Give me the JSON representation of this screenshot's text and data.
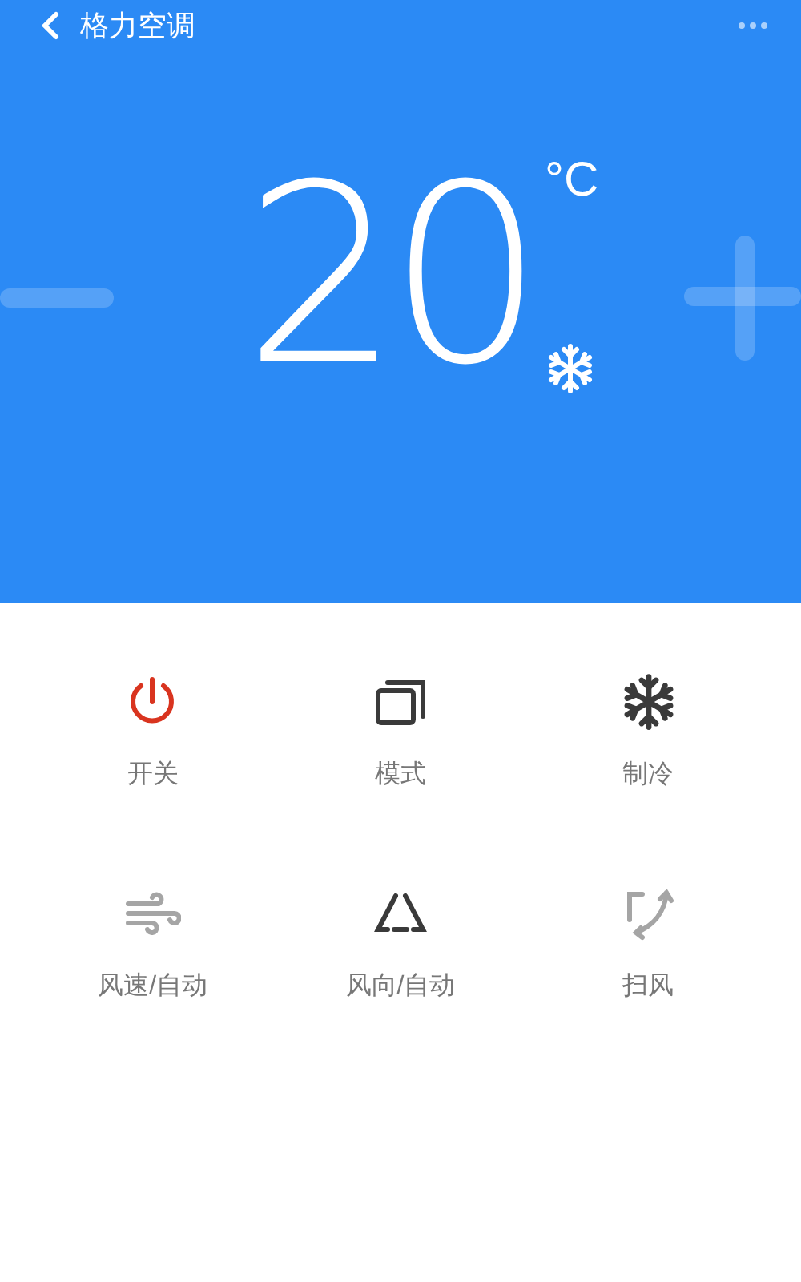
{
  "header": {
    "title": "格力空调"
  },
  "temperature": {
    "value": "20",
    "unit": "°C"
  },
  "controls": [
    {
      "label": "开关",
      "kind": "power",
      "active": true,
      "disabled": false
    },
    {
      "label": "模式",
      "kind": "mode",
      "active": false,
      "disabled": false
    },
    {
      "label": "制冷",
      "kind": "cool",
      "active": false,
      "disabled": false
    },
    {
      "label": "风速/自动",
      "kind": "fan",
      "active": false,
      "disabled": true
    },
    {
      "label": "风向/自动",
      "kind": "direction",
      "active": false,
      "disabled": false
    },
    {
      "label": "扫风",
      "kind": "swing",
      "active": false,
      "disabled": true
    }
  ]
}
